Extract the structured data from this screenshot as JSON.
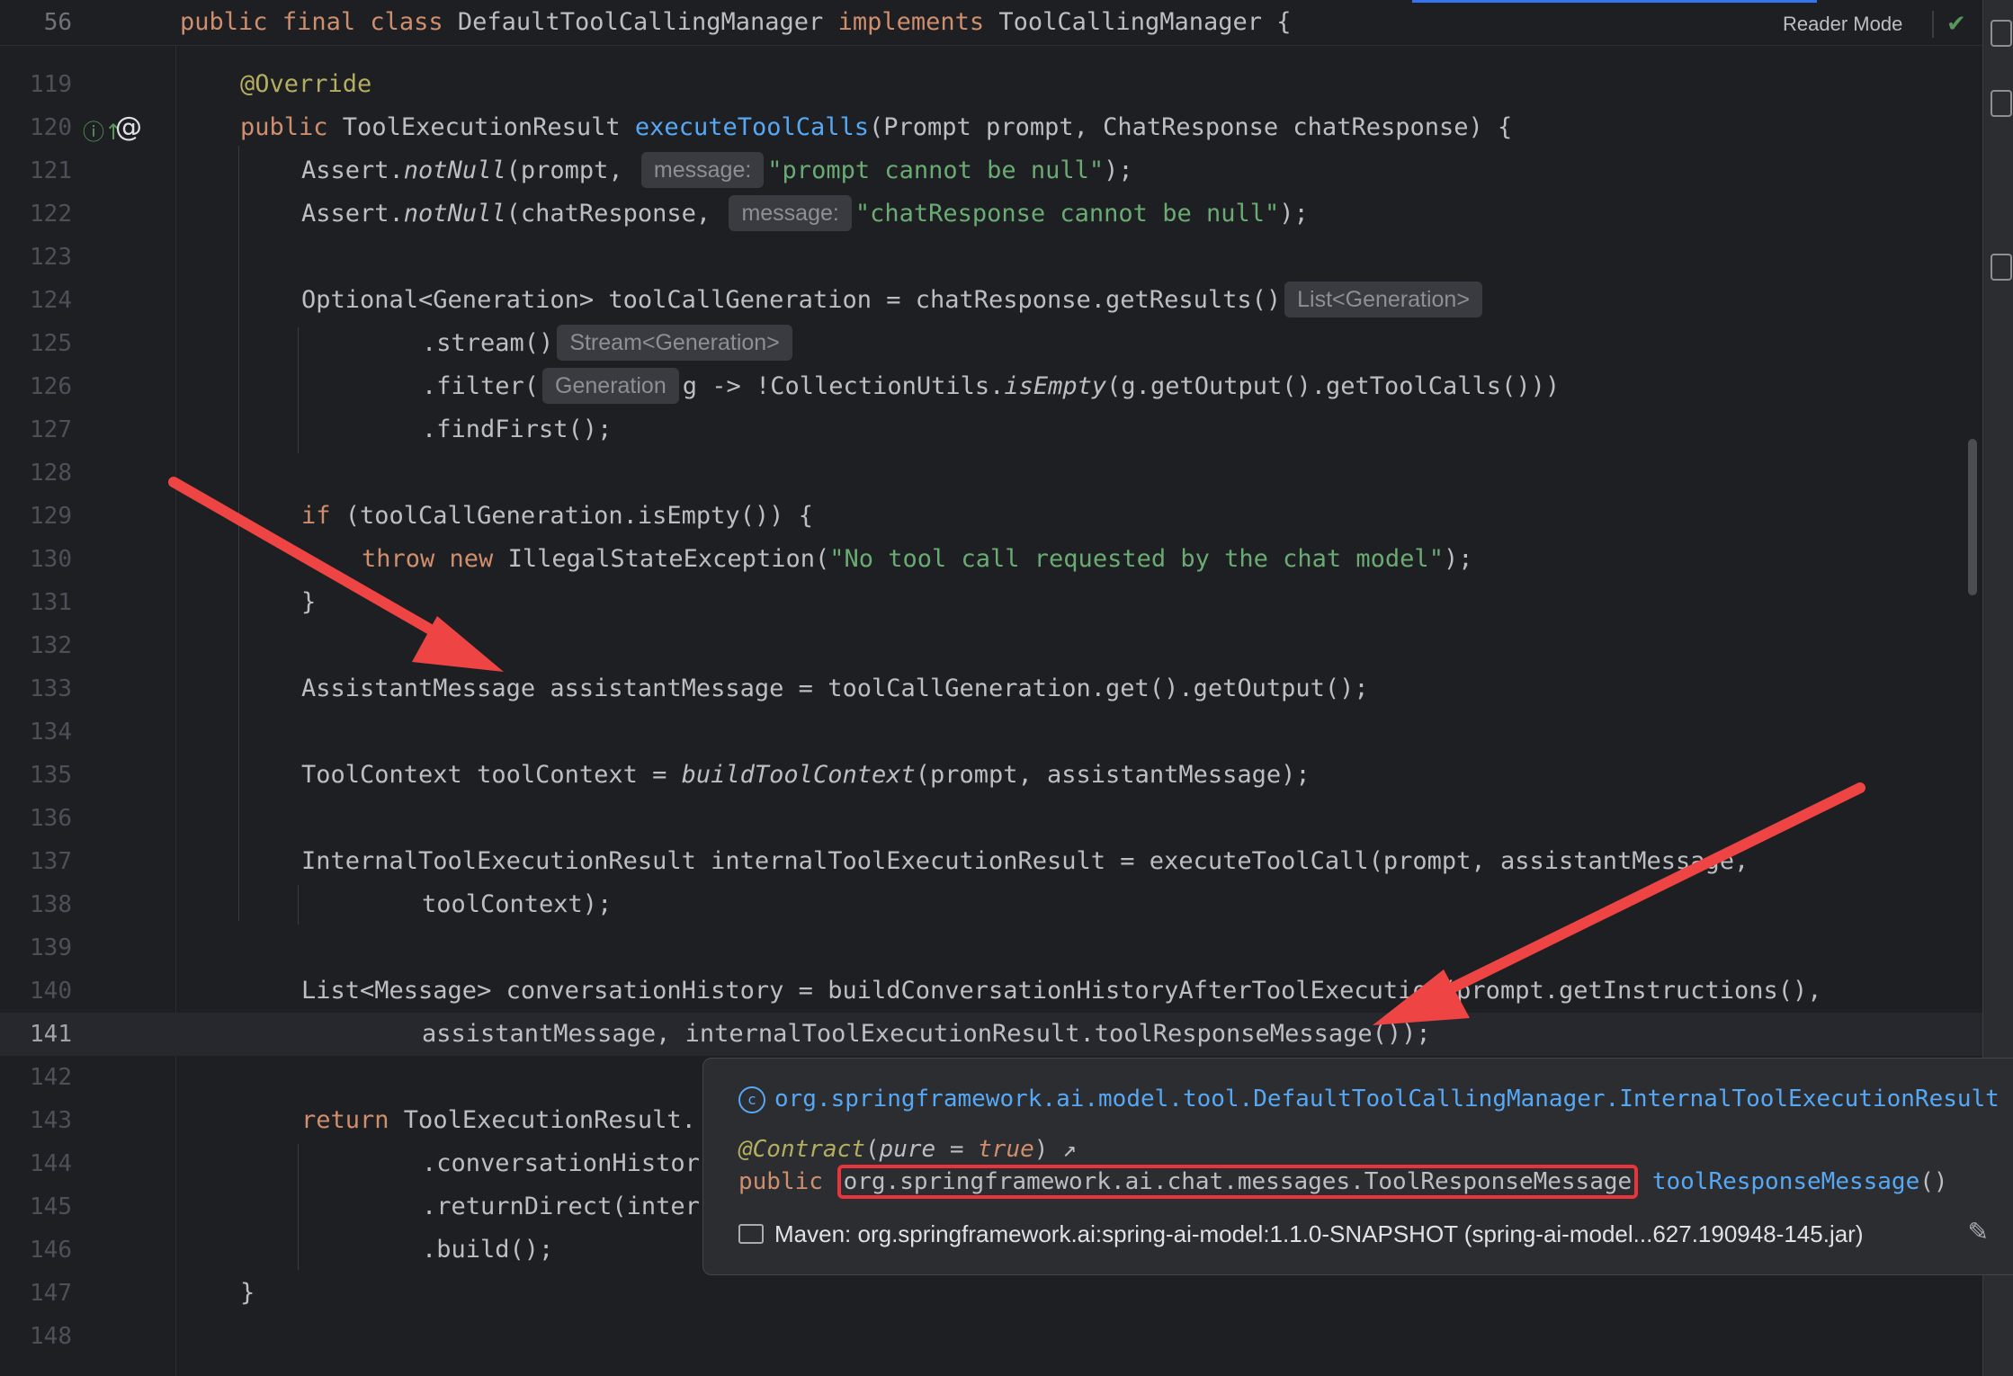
{
  "sticky_header": {
    "line_number": "56",
    "kw_public": "public",
    "kw_final": "final",
    "kw_class": "class",
    "class_name": "DefaultToolCallingManager",
    "kw_implements": "implements",
    "interface_name": "ToolCallingManager {"
  },
  "toolbar": {
    "reader_mode": "Reader Mode",
    "status_icon": "check-icon"
  },
  "gutter_icons": [
    "implementation-up-icon",
    "at-annotation-icon"
  ],
  "lines": {
    "l119": {
      "n": "119",
      "annotation": "@Override"
    },
    "l120": {
      "n": "120",
      "kw": "public",
      "type": " ToolExecutionResult ",
      "method": "executeToolCalls",
      "params": "(Prompt prompt, ChatResponse chatResponse) {"
    },
    "l121": {
      "n": "121",
      "a": "Assert.",
      "b": "notNull",
      "c": "(prompt,",
      "hint": "message:",
      "str": "\"prompt cannot be null\"",
      "end": ");"
    },
    "l122": {
      "n": "122",
      "a": "Assert.",
      "b": "notNull",
      "c": "(chatResponse,",
      "hint": "message:",
      "str": "\"chatResponse cannot be null\"",
      "end": ");"
    },
    "l123": {
      "n": "123"
    },
    "l124": {
      "n": "124",
      "code": "Optional<Generation> toolCallGeneration = chatResponse.getResults()",
      "hint": "List<Generation>"
    },
    "l125": {
      "n": "125",
      "code": ".stream()",
      "hint": "Stream<Generation>"
    },
    "l126": {
      "n": "126",
      "a": ".filter(",
      "hint": "Generation",
      "b": "g -> !CollectionUtils.",
      "c": "isEmpty",
      "d": "(g.getOutput().getToolCalls()))"
    },
    "l127": {
      "n": "127",
      "code": ".findFirst();"
    },
    "l128": {
      "n": "128"
    },
    "l129": {
      "n": "129",
      "kw": "if",
      "code": " (toolCallGeneration.isEmpty()) {"
    },
    "l130": {
      "n": "130",
      "kw1": "throw",
      "kw2": "new",
      "code": "IllegalStateException(",
      "str": "\"No tool call requested by the chat model\"",
      "end": ");"
    },
    "l131": {
      "n": "131",
      "code": "}"
    },
    "l132": {
      "n": "132"
    },
    "l133": {
      "n": "133",
      "code": "AssistantMessage assistantMessage = toolCallGeneration.get().getOutput();"
    },
    "l134": {
      "n": "134"
    },
    "l135": {
      "n": "135",
      "a": "ToolContext toolContext = ",
      "b": "buildToolContext",
      "c": "(prompt, assistantMessage);"
    },
    "l136": {
      "n": "136"
    },
    "l137": {
      "n": "137",
      "code": "InternalToolExecutionResult internalToolExecutionResult = executeToolCall(prompt, assistantMessage,"
    },
    "l138": {
      "n": "138",
      "code": "toolContext);"
    },
    "l139": {
      "n": "139"
    },
    "l140": {
      "n": "140",
      "code": "List<Message> conversationHistory = buildConversationHistoryAfterToolExecution(prompt.getInstructions(),"
    },
    "l141": {
      "n": "141",
      "code": "assistantMessage, internalToolExecutionResult.toolResponseMessage());"
    },
    "l142": {
      "n": "142"
    },
    "l143": {
      "n": "143",
      "kw": "return",
      "code": " ToolExecutionResult."
    },
    "l144": {
      "n": "144",
      "code": ".conversationHistor"
    },
    "l145": {
      "n": "145",
      "code": ".returnDirect(inter"
    },
    "l146": {
      "n": "146",
      "code": ".build();"
    },
    "l147": {
      "n": "147",
      "code": "}"
    },
    "l148": {
      "n": "148"
    }
  },
  "popup": {
    "class_icon": "class-icon",
    "class_path": "org.springframework.ai.model.tool.DefaultToolCallingManager.InternalToolExecutionResult",
    "contract_a": "@Contract",
    "contract_b": "(",
    "contract_pure": "pure",
    "contract_eq": " = ",
    "contract_true": "true",
    "contract_end": ")",
    "contract_link": "↗",
    "sig_kw": "public",
    "return_type": "org.springframework.ai.chat.messages.ToolResponseMessage",
    "method": "toolResponseMessage",
    "method_end": "()",
    "maven_icon": "library-icon",
    "maven": "Maven: org.springframework.ai:spring-ai-model:1.1.0-SNAPSHOT (spring-ai-model...627.190948-145.jar)",
    "edit_icon": "pencil-icon"
  },
  "annotation_colors": {
    "arrow": "#ef4444",
    "highlight_box": "#e8343a"
  }
}
